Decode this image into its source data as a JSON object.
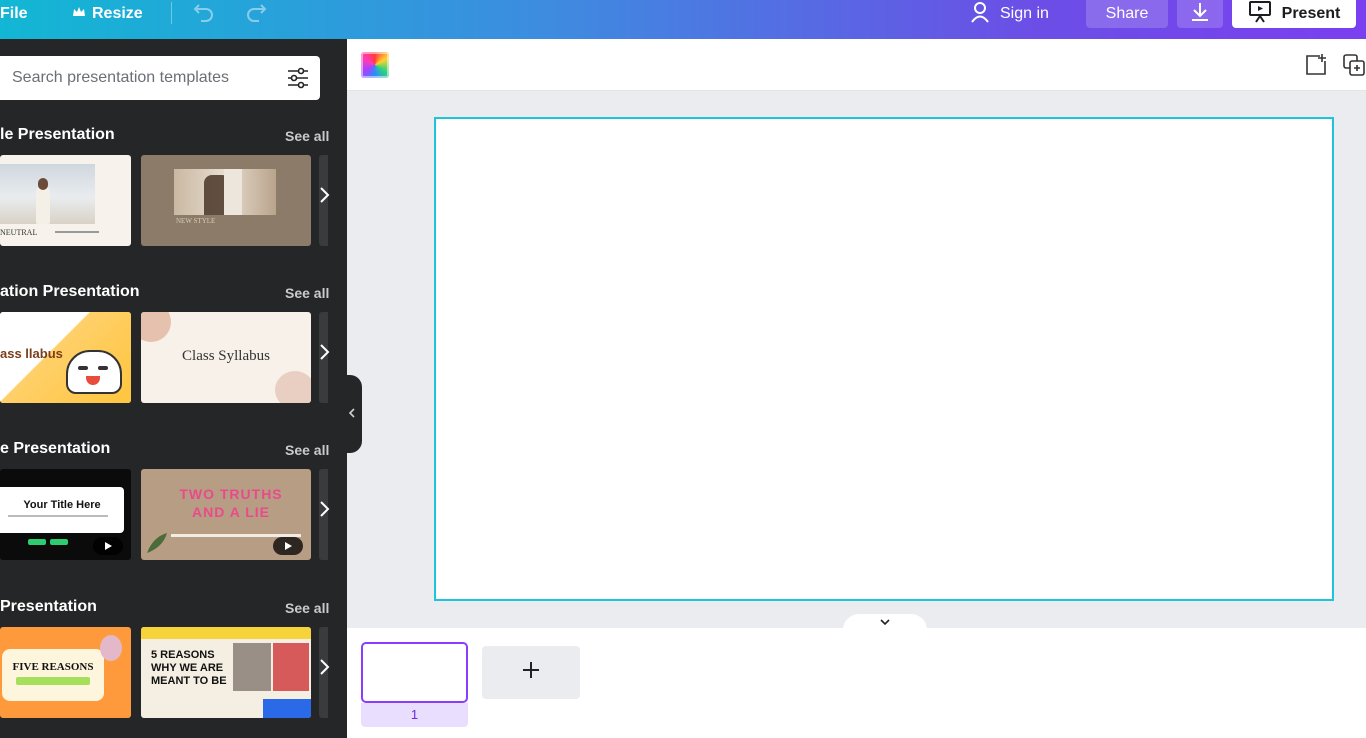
{
  "topbar": {
    "file_label": "File",
    "resize_label": "Resize",
    "signin_label": "Sign in",
    "share_label": "Share",
    "present_label": "Present"
  },
  "sidebar": {
    "search": {
      "placeholder": "Search presentation templates"
    },
    "sections": [
      {
        "title": "le Presentation",
        "see_all": "See all",
        "thumbs": [
          "NEUTRAL",
          "NEW STYLE"
        ]
      },
      {
        "title": "ation Presentation",
        "see_all": "See all",
        "thumbs": [
          "ass llabus",
          "Class Syllabus"
        ]
      },
      {
        "title": "e Presentation",
        "see_all": "See all",
        "thumbs": [
          "Your Title Here",
          "TWO TRUTHS AND A LIE"
        ]
      },
      {
        "title": " Presentation",
        "see_all": "See all",
        "thumbs": [
          "FIVE REASONS",
          "5 REASONS WHY WE ARE MEANT TO BE"
        ]
      }
    ]
  },
  "pages": {
    "current_page": "1"
  },
  "colors": {
    "accent": "#8b3dff",
    "selection": "#20c4d9",
    "sidebar_bg": "#252627"
  }
}
